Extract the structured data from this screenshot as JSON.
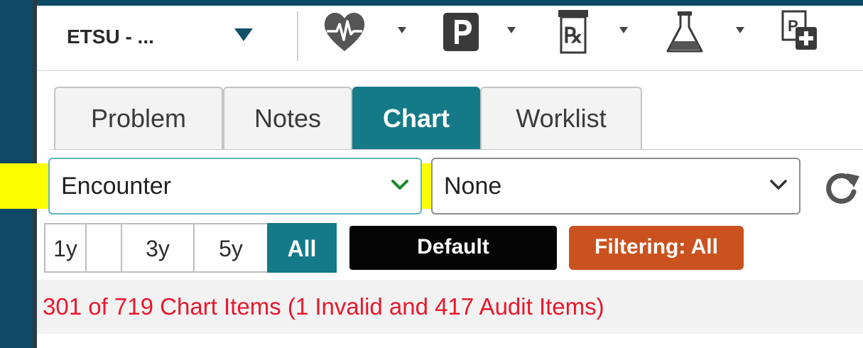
{
  "toolbar": {
    "org_label": "ETSU - ...",
    "icons": [
      "heart-monitor-icon",
      "parking-icon",
      "prescription-icon",
      "lab-flask-icon",
      "add-document-icon"
    ]
  },
  "tabs": [
    {
      "label": "Problem",
      "active": false
    },
    {
      "label": "Notes",
      "active": false
    },
    {
      "label": "Chart",
      "active": true
    },
    {
      "label": "Worklist",
      "active": false
    }
  ],
  "filters": {
    "group_by_value": "Encounter",
    "secondary_value": "None"
  },
  "time_ranges": [
    {
      "label": "1y",
      "active": false
    },
    {
      "label": "3y",
      "active": false
    },
    {
      "label": "5y",
      "active": false
    },
    {
      "label": "All",
      "active": true
    }
  ],
  "buttons": {
    "default_label": "Default",
    "filtering_label": "Filtering: All"
  },
  "status": {
    "text": "301 of 719 Chart Items (1 Invalid and 417 Audit Items)"
  },
  "colors": {
    "frame": "#0e4a66",
    "accent_teal": "#147a88",
    "filter_orange": "#c9521f",
    "status_red": "#e8182c",
    "highlight_yellow": "#fbff00"
  }
}
